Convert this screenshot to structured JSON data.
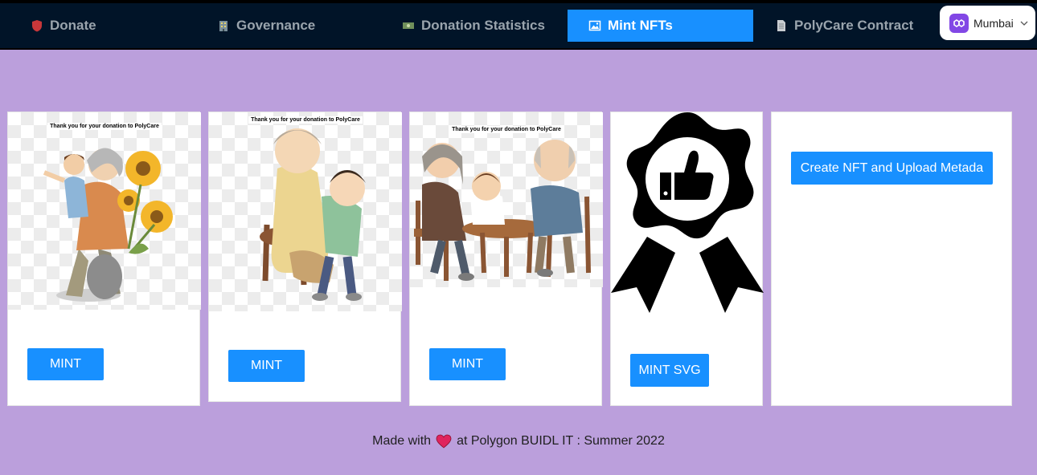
{
  "nav": {
    "items": [
      {
        "icon": "red-shield-icon",
        "label": "Donate"
      },
      {
        "icon": "building-icon",
        "label": "Governance"
      },
      {
        "icon": "money-icon",
        "label": "Donation Statistics"
      },
      {
        "icon": "framed-picture-icon",
        "label": "Mint NFTs",
        "active": true
      },
      {
        "icon": "page-icon",
        "label": "PolyCare Contract"
      }
    ],
    "network": {
      "icon": "polygon-logo-icon",
      "label": "Mumbai"
    }
  },
  "cards": [
    {
      "caption": "Thank you for your donation to PolyCare",
      "button": "MINT",
      "illustration": "grandmother-child-sunflowers"
    },
    {
      "caption": "Thank you for your donation to PolyCare",
      "button": "MINT",
      "illustration": "grandmother-hugging-boy"
    },
    {
      "caption": "Thank you for your donation to PolyCare",
      "button": "MINT",
      "illustration": "grandparents-child-table"
    },
    {
      "button": "MINT SVG",
      "illustration": "thumbs-up-award-badge"
    }
  ],
  "create": {
    "button": "Create NFT and Upload Metada"
  },
  "footer": {
    "prefix": "Made with",
    "suffix": "at Polygon BUIDL IT : Summer 2022"
  },
  "colors": {
    "accent": "#1890ff",
    "background": "#bb9fdc",
    "nav": "#011428",
    "polygon": "#8247e5"
  }
}
